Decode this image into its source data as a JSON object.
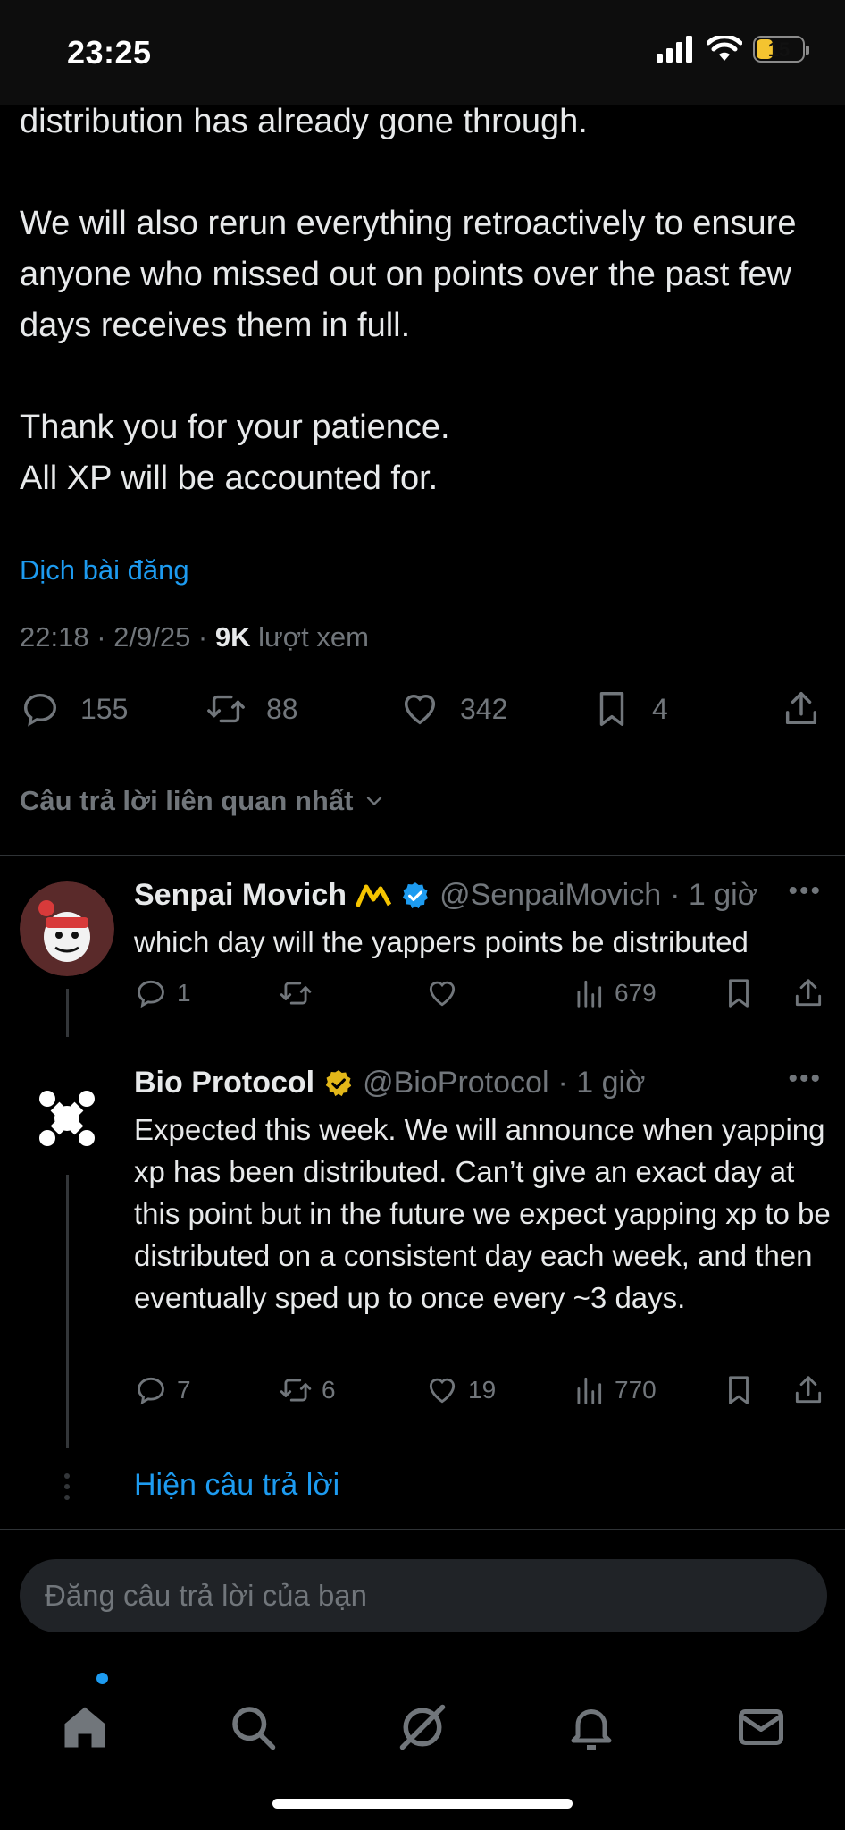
{
  "status_bar": {
    "time": "23:25",
    "battery": "15"
  },
  "post": {
    "body": "distribution has already gone through.\n\nWe will also rerun everything retroactively to ensure anyone who missed out on points over the past few days receives them in full.\n\nThank you for your patience.\nAll XP will be accounted for.",
    "translate": "Dịch bài đăng",
    "time_date": "22:18 · 2/9/25 · ",
    "views": "9K",
    "views_label": " lượt xem",
    "stats": {
      "replies": "155",
      "reposts": "88",
      "likes": "342",
      "bookmarks": "4"
    }
  },
  "sort_label": "Câu trả lời liên quan nhất",
  "replies": [
    {
      "name": "Senpai Movich",
      "handle": "@SenpaiMovich",
      "time": "· 1 giờ",
      "text": "which day will the yappers points be distributed",
      "stats": {
        "replies": "1",
        "reposts": "",
        "likes": "",
        "views": "679"
      },
      "verified_color": "#1d9bf0"
    },
    {
      "name": "Bio Protocol",
      "handle": "@BioProtocol",
      "time": "· 1 giờ",
      "text": "Expected this week. We will announce when yapping xp has been distributed. Can’t give an exact day at this point but in the future we expect yapping xp to be distributed on a consistent day each week, and then eventually sped up to once every ~3 days.",
      "stats": {
        "replies": "7",
        "reposts": "6",
        "likes": "19",
        "views": "770"
      },
      "verified_color": "#e2b719"
    }
  ],
  "show_replies": "Hiện câu trả lời",
  "compose": {
    "placeholder": "Đăng câu trả lời của bạn"
  },
  "tabbar": [
    "home-icon",
    "search-icon",
    "grok-icon",
    "notifications-icon",
    "messages-icon"
  ]
}
